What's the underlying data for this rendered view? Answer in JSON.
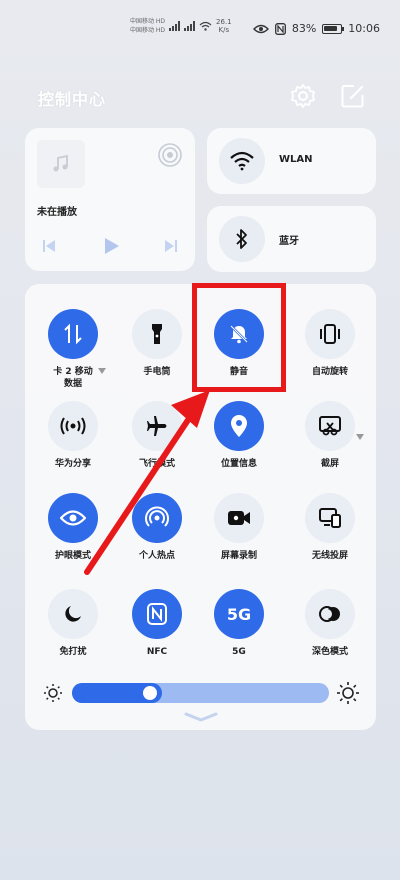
{
  "status_bar": {
    "carrier1": "中国移动 HD",
    "carrier2": "中国移动 HD",
    "net_speed_value": "26.1",
    "net_speed_unit": "K/s",
    "battery": "83%",
    "time": "10:06"
  },
  "header": {
    "title": "控制中心",
    "settings_icon": "gear-icon",
    "edit_icon": "edit-icon"
  },
  "media": {
    "status": "未在播放",
    "album_icon": "music-note-icon",
    "cast_icon": "cast-icon"
  },
  "connectivity": {
    "wlan_label": "WLAN",
    "bluetooth_label": "蓝牙"
  },
  "toggles": [
    {
      "label": "卡 2 移动\n数据",
      "icon": "mobile-data-icon",
      "active": true
    },
    {
      "label": "手电筒",
      "icon": "flashlight-icon",
      "active": false
    },
    {
      "label": "静音",
      "icon": "bell-mute-icon",
      "active": true
    },
    {
      "label": "自动旋转",
      "icon": "rotate-icon",
      "active": false
    },
    {
      "label": "华为分享",
      "icon": "share-icon",
      "active": false
    },
    {
      "label": "飞行模式",
      "icon": "airplane-icon",
      "active": false
    },
    {
      "label": "位置信息",
      "icon": "location-icon",
      "active": true
    },
    {
      "label": "截屏",
      "icon": "screenshot-icon",
      "active": false
    },
    {
      "label": "护眼模式",
      "icon": "eye-icon",
      "active": true
    },
    {
      "label": "个人热点",
      "icon": "hotspot-icon",
      "active": true
    },
    {
      "label": "屏幕录制",
      "icon": "record-icon",
      "active": false
    },
    {
      "label": "无线投屏",
      "icon": "cast-screen-icon",
      "active": false
    },
    {
      "label": "免打扰",
      "icon": "moon-icon",
      "active": false
    },
    {
      "label": "NFC",
      "icon": "nfc-icon",
      "active": true
    },
    {
      "label": "5G",
      "icon": "5g-icon",
      "active": true
    },
    {
      "label": "深色模式",
      "icon": "dark-mode-icon",
      "active": false
    }
  ],
  "brightness": {
    "level": 0.35
  },
  "colors": {
    "accent": "#2f6ae8",
    "annotation": "#e8191a"
  }
}
